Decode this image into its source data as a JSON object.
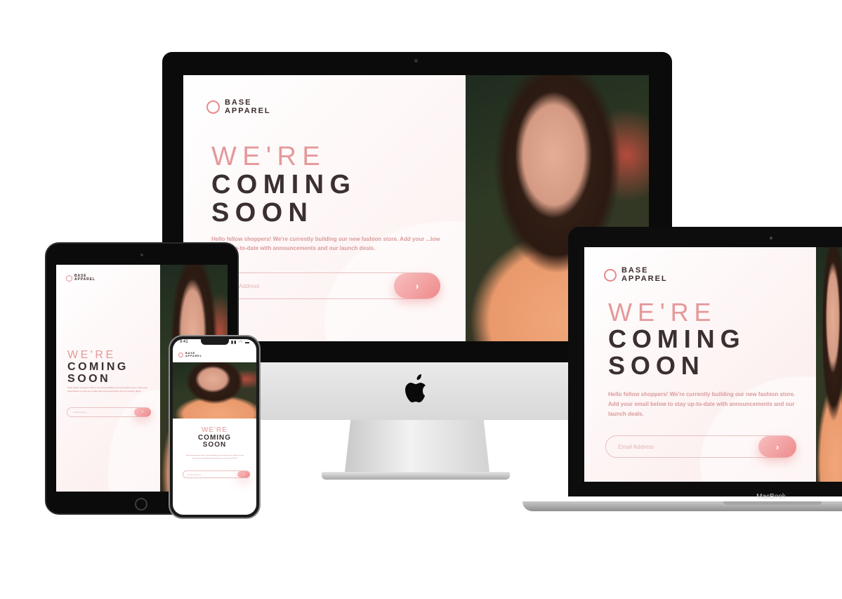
{
  "brand": {
    "line1": "BASE",
    "line2": "APPAREL"
  },
  "hero": {
    "line1": "WE'RE",
    "line2": "COMING",
    "line3": "SOON"
  },
  "intro": "Hello fellow shoppers! We're currently building our new fashion store. Add your email below to stay up-to-date with announcements and our launch deals.",
  "imac": {
    "intro_visible": "Hello fellow shoppers! We're currently building our new fashion store. Add your ...low to stay up-to-date with announcements and our launch deals.",
    "email_visible": "Address"
  },
  "form": {
    "placeholder": "Email Address",
    "submit_glyph": "›"
  },
  "macbook": {
    "label": "MacBook"
  },
  "iphone": {
    "time": "9:41",
    "status_icons": "▮▮ ◠ ▬"
  },
  "colors": {
    "accent": "#ee8a8b",
    "accent_light": "#f8bfbf",
    "text_pink": "#e4999a",
    "text_dark": "#3b2f2f"
  },
  "icons": {
    "submit": "chevron-right-icon",
    "logo": "ring-icon",
    "apple": "apple-logo-icon"
  }
}
